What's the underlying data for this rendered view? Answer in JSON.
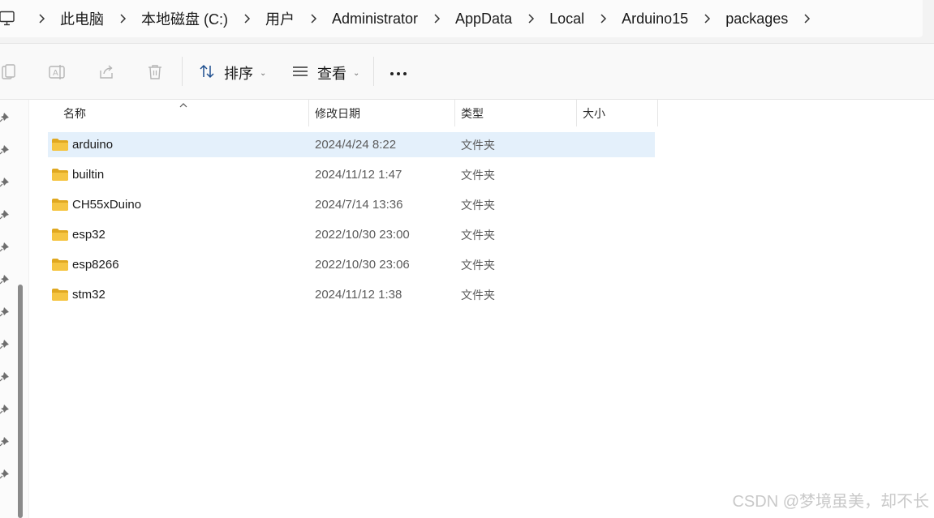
{
  "breadcrumb": {
    "items": [
      "此电脑",
      "本地磁盘 (C:)",
      "用户",
      "Administrator",
      "AppData",
      "Local",
      "Arduino15",
      "packages"
    ]
  },
  "toolbar": {
    "sort_label": "排序",
    "view_label": "查看"
  },
  "columns": {
    "name": "名称",
    "modified": "修改日期",
    "type": "类型",
    "size": "大小"
  },
  "files": [
    {
      "name": "arduino",
      "modified": "2024/4/24 8:22",
      "type": "文件夹",
      "size": ""
    },
    {
      "name": "builtin",
      "modified": "2024/11/12 1:47",
      "type": "文件夹",
      "size": ""
    },
    {
      "name": "CH55xDuino",
      "modified": "2024/7/14 13:36",
      "type": "文件夹",
      "size": ""
    },
    {
      "name": "esp32",
      "modified": "2022/10/30 23:00",
      "type": "文件夹",
      "size": ""
    },
    {
      "name": "esp8266",
      "modified": "2022/10/30 23:06",
      "type": "文件夹",
      "size": ""
    },
    {
      "name": "stm32",
      "modified": "2024/11/12 1:38",
      "type": "文件夹",
      "size": ""
    }
  ],
  "selected_index": 0,
  "watermark": "CSDN @梦境虽美，却不长",
  "colors": {
    "selection": "#e4f0fb",
    "folder": "#f5c542",
    "folder_dark": "#e0a820"
  },
  "icons": {
    "computer": "computer-icon",
    "copy": "copy-icon",
    "rename": "rename-icon",
    "share": "share-icon",
    "delete": "delete-icon",
    "sort": "sort-icon",
    "view": "view-icon",
    "more": "more-icon",
    "folder": "folder-icon",
    "pin": "pin-icon"
  }
}
